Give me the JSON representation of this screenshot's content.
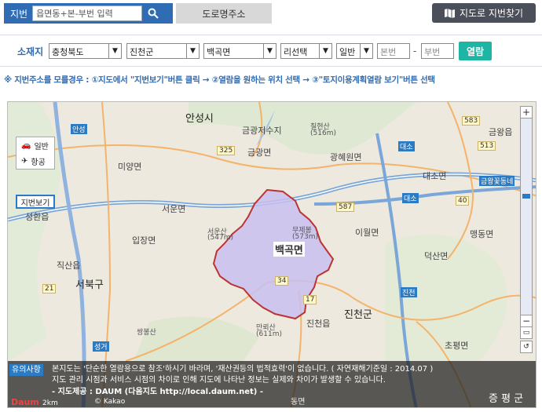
{
  "top": {
    "jibun_label": "지번",
    "search_placeholder": "읍면동+본-부번 입력",
    "road_tab": "도로명주소",
    "map_button": "지도로 지번찾기"
  },
  "filter": {
    "label": "소재지",
    "province": "충청북도",
    "county": "진천군",
    "township": "백곡면",
    "village": "리선택",
    "land_type": "일반",
    "main_no_placeholder": "본번",
    "dash": "-",
    "sub_no_placeholder": "부번",
    "open_button": "열람"
  },
  "hint": "※ 지번주소를 모를경우 : ①지도에서 \"지번보기\"버튼 클릭 → ②열람을 원하는 위치 선택 → ③\"토지이용계획열람 보기\"버튼 선택",
  "map": {
    "type_normal": "일반",
    "type_air": "항공",
    "jibun_view": "지번보기",
    "highlight_name": "백곡면",
    "labels": {
      "anseong": "안성시",
      "anseong_ic": "안성",
      "ic": "IC",
      "geumgwang_res": "금광저수지",
      "chilhyeonsan": "칠현산",
      "chilhyeon_h": "(516m)",
      "geumgwang": "금광면",
      "gwanghyewon": "광혜원면",
      "miyang": "미양면",
      "seoun": "서운면",
      "seounsan": "서운산",
      "seoun_h": "(547m)",
      "mujebong": "무제봉",
      "mujebong_h": "(573m)",
      "ijuk": "이월면",
      "ipjang": "입장면",
      "seonghwan": "성환읍",
      "jiksan": "직산읍",
      "seobuk": "서북구",
      "manroe": "만뢰산",
      "manroe_h": "(611m)",
      "jincheon_eup": "진천읍",
      "jincheon": "진천군",
      "daeso": "대소면",
      "geumwang": "금왕읍",
      "maengdong": "맹동면",
      "deoksan": "덕산면",
      "chopyeong": "초평면",
      "jeungpyeong": "증평군",
      "seonggeo": "성거읍",
      "ssangbong": "쌍봉산",
      "daeso_ic": "대소",
      "jincheon_ic": "진천",
      "geumwang_ic": "금왕꽃동네",
      "seonggeo_ic": "성거",
      "mokcheon": "목천",
      "choinpyeong": "초평",
      "dong": "동면",
      "ppyeong": "증 평 군"
    },
    "roads": [
      "325",
      "583",
      "587",
      "34",
      "17",
      "21",
      "513",
      "40",
      "35"
    ]
  },
  "notice": {
    "tag": "유의사항",
    "line1": "본지도는 '단순한 열람용으로 참조'하시기 바라며, '재산권등의 법적효력'이 없습니다. ( 자연재해기준일 : 2014.07 )",
    "line2": "지도 관리 시점과 서비스 시점의 차이로 인해 지도에 나타난 정보는 실제와 차이가 발생할 수 있습니다.",
    "line3": "- 지도제공 : DAUM (다음지도 http://local.daum.net) -",
    "brand": "Daum",
    "scale": "2km",
    "kakao": "© Kakao"
  }
}
